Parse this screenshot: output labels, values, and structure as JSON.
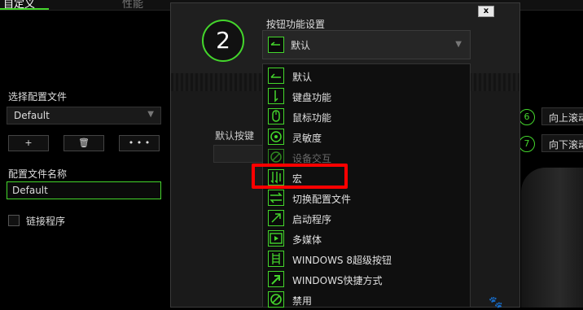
{
  "tabs": [
    {
      "label": "自定义"
    },
    {
      "label": "性能"
    }
  ],
  "left_panel": {
    "select_profile_label": "选择配置文件",
    "profile_value": "Default",
    "buttons": {
      "add": "+",
      "delete": "🗑",
      "more": "• • •"
    },
    "profile_name_label": "配置文件名称",
    "profile_name_value": "Default",
    "link_program_label": "链接程序"
  },
  "right_panel": {
    "scroll_up": {
      "number": "6",
      "label": "向上滚动"
    },
    "scroll_down": {
      "number": "7",
      "label": "向下滚动"
    }
  },
  "modal": {
    "close_label": "x",
    "step_number": "2",
    "section_title": "按钮功能设置",
    "default_key_label": "默认按键",
    "selected_function": {
      "label": "默认",
      "icon": "default-icon"
    },
    "menu_items": [
      {
        "label": "默认",
        "icon": "default-icon",
        "enabled": true
      },
      {
        "label": "键盘功能",
        "icon": "keyboard-icon",
        "enabled": true
      },
      {
        "label": "鼠标功能",
        "icon": "mouse-icon",
        "enabled": true
      },
      {
        "label": "灵敏度",
        "icon": "sensitivity-icon",
        "enabled": true
      },
      {
        "label": "设备交互",
        "icon": "inter-device-icon",
        "enabled": false
      },
      {
        "label": "宏",
        "icon": "macro-icon",
        "enabled": true,
        "highlighted": true
      },
      {
        "label": "切换配置文件",
        "icon": "switch-profile-icon",
        "enabled": true
      },
      {
        "label": "启动程序",
        "icon": "launch-program-icon",
        "enabled": true
      },
      {
        "label": "多媒体",
        "icon": "multimedia-icon",
        "enabled": true
      },
      {
        "label": "WINDOWS 8超级按钮",
        "icon": "windows8-charms-icon",
        "enabled": true
      },
      {
        "label": "WINDOWS快捷方式",
        "icon": "windows-shortcut-icon",
        "enabled": true
      },
      {
        "label": "禁用",
        "icon": "disable-icon",
        "enabled": true
      }
    ]
  },
  "colors": {
    "accent": "#44d62c",
    "highlight": "#ff0000",
    "background": "#000000"
  }
}
